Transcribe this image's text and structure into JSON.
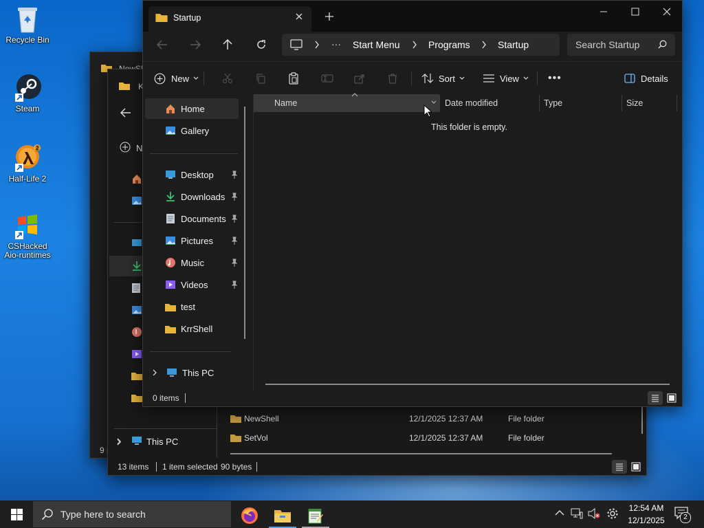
{
  "desktop": {
    "icons": [
      {
        "label": "Recycle Bin"
      },
      {
        "label": "Steam"
      },
      {
        "label": "Half-Life 2"
      },
      {
        "label": "CSHacked Aio-runtimes"
      }
    ]
  },
  "back_window": {
    "tab_title_partial": "NewSh",
    "inner_tab_partial": "K",
    "new_partial": "N",
    "footer_partial": "9 i"
  },
  "middle_window": {
    "rows": [
      {
        "name": "NewShell",
        "date": "12/1/2025 12:37 AM",
        "type": "File folder"
      },
      {
        "name": "SetVol",
        "date": "12/1/2025 12:37 AM",
        "type": "File folder"
      }
    ],
    "nav_this_pc": "This PC",
    "status": {
      "items": "13 items",
      "selected": "1 item selected",
      "size": "90 bytes"
    }
  },
  "front_window": {
    "tab_title": "Startup",
    "breadcrumb": [
      "Start Menu",
      "Programs",
      "Startup"
    ],
    "search_placeholder": "Search Startup",
    "toolbar": {
      "new": "New",
      "sort": "Sort",
      "view": "View",
      "details": "Details"
    },
    "columns": {
      "name": "Name",
      "date": "Date modified",
      "type": "Type",
      "size": "Size"
    },
    "empty_message": "This folder is empty.",
    "nav": {
      "home": "Home",
      "gallery": "Gallery",
      "pinned": [
        "Desktop",
        "Downloads",
        "Documents",
        "Pictures",
        "Music",
        "Videos"
      ],
      "folders": [
        "test",
        "KrrShell"
      ],
      "this_pc": "This PC"
    },
    "status_items": "0 items"
  },
  "taskbar": {
    "search_placeholder": "Type here to search",
    "time": "12:54 AM",
    "date": "12/1/2025",
    "notification_count": "2"
  },
  "colors": {
    "accent": "#0078d4",
    "window_bg": "#1c1c1c",
    "folder": "#e8b53c"
  }
}
